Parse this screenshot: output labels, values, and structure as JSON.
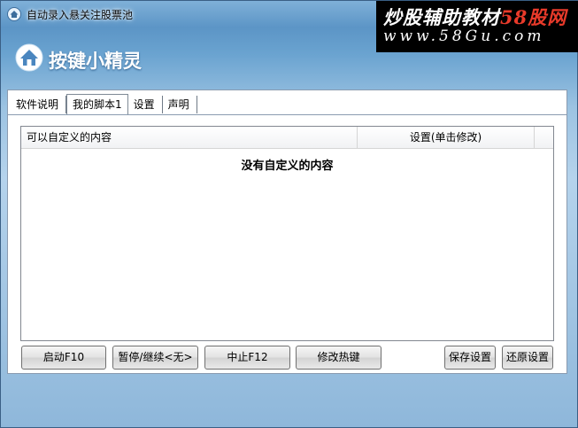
{
  "window": {
    "title": "自动录入悬关注股票池"
  },
  "watermark": {
    "line1_prefix": "炒股辅助教材",
    "line1_highlight": "58股网",
    "line2": "www.58Gu.com"
  },
  "brand": {
    "name": "按键小精灵"
  },
  "tabs": [
    {
      "label": "软件说明",
      "active": false
    },
    {
      "label": "我的脚本1",
      "active": true
    },
    {
      "label": "设置",
      "active": false
    },
    {
      "label": "声明",
      "active": false
    }
  ],
  "list": {
    "columns": [
      "可以自定义的内容",
      "设置(单击修改)"
    ],
    "empty_message": "没有自定义的内容"
  },
  "buttons": {
    "start": "启动F10",
    "pause": "暂停/继续<无>",
    "stop": "中止F12",
    "hotkey": "修改热键",
    "save": "保存设置",
    "restore": "还原设置"
  },
  "colors": {
    "window_gradient_top": "#7fb0d8",
    "window_gradient_bottom": "#8eb7da",
    "watermark_bg": "#000000",
    "watermark_highlight": "#e83a2a"
  },
  "icons": {
    "title": "home-icon",
    "brand": "house-logo-icon"
  }
}
